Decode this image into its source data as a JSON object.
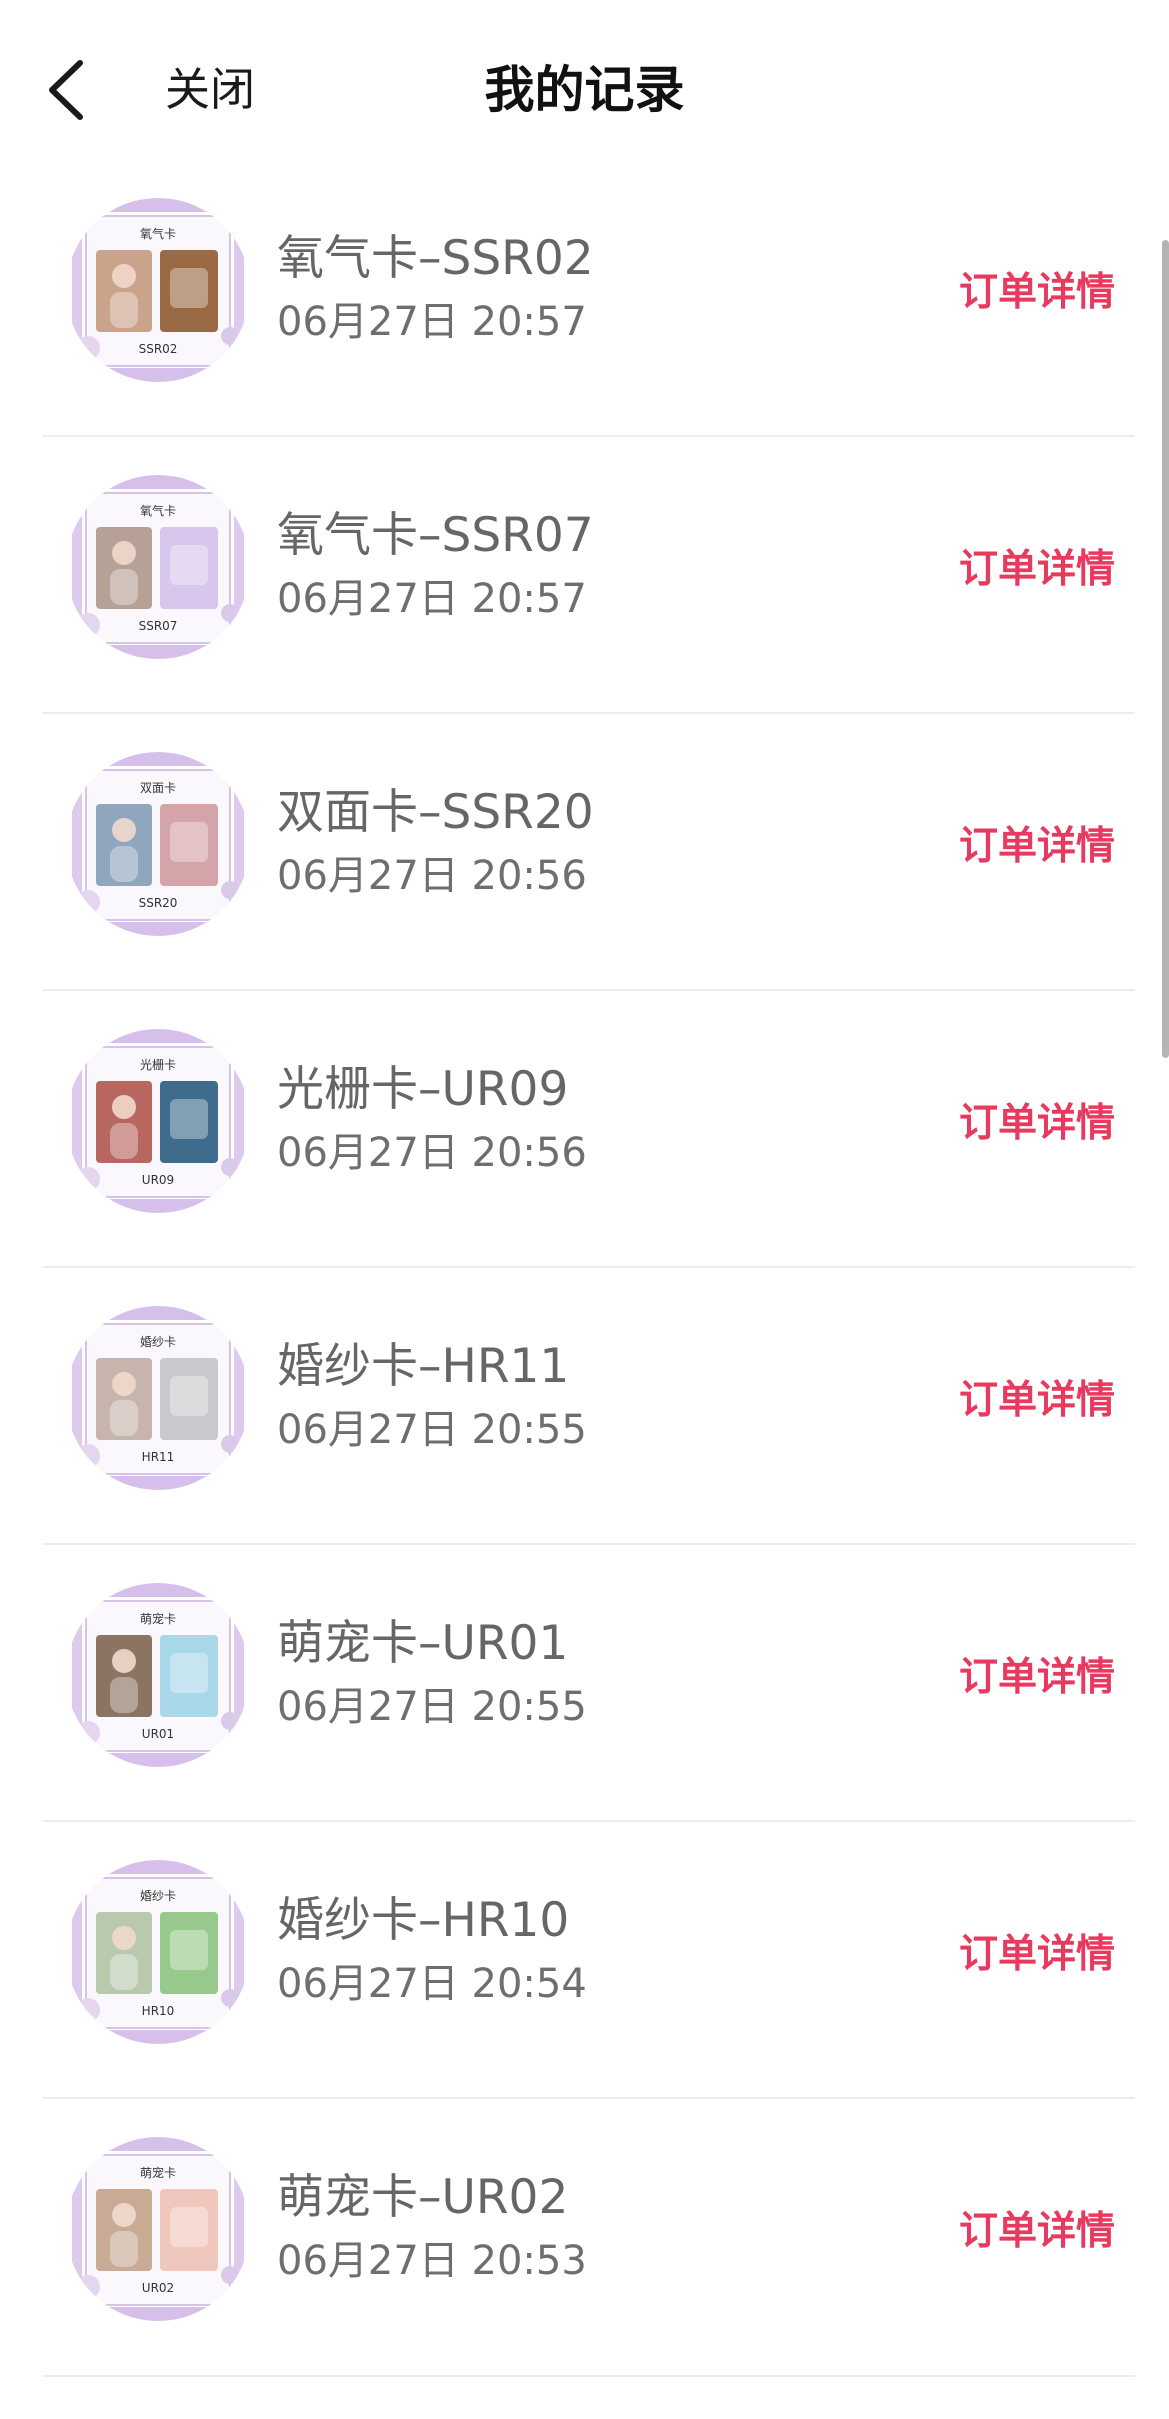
{
  "header": {
    "close_label": "关闭",
    "title": "我的记录"
  },
  "records": [
    {
      "title": "氧气卡–SSR02",
      "time": "06月27日  20:57",
      "action": "订单详情",
      "card_label": "氧气卡",
      "card_code": "SSR02",
      "left_color": "#c9a48a",
      "right_color": "#9a6a45"
    },
    {
      "title": "氧气卡–SSR07",
      "time": "06月27日  20:57",
      "action": "订单详情",
      "card_label": "氧气卡",
      "card_code": "SSR07",
      "left_color": "#b7a196",
      "right_color": "#d8c6ec"
    },
    {
      "title": "双面卡–SSR20",
      "time": "06月27日  20:56",
      "action": "订单详情",
      "card_label": "双面卡",
      "card_code": "SSR20",
      "left_color": "#8fa6be",
      "right_color": "#d5a4a8"
    },
    {
      "title": "光栅卡–UR09",
      "time": "06月27日  20:56",
      "action": "订单详情",
      "card_label": "光栅卡",
      "card_code": "UR09",
      "left_color": "#b86660",
      "right_color": "#3f6c8c"
    },
    {
      "title": "婚纱卡–HR11",
      "time": "06月27日  20:55",
      "action": "订单详情",
      "card_label": "婚纱卡",
      "card_code": "HR11",
      "left_color": "#c7b4ad",
      "right_color": "#c9c9cd"
    },
    {
      "title": "萌宠卡–UR01",
      "time": "06月27日  20:55",
      "action": "订单详情",
      "card_label": "萌宠卡",
      "card_code": "UR01",
      "left_color": "#8c7462",
      "right_color": "#a9d8ea"
    },
    {
      "title": "婚纱卡–HR10",
      "time": "06月27日  20:54",
      "action": "订单详情",
      "card_label": "婚纱卡",
      "card_code": "HR10",
      "left_color": "#b8c9ae",
      "right_color": "#98c98c"
    },
    {
      "title": "萌宠卡–UR02",
      "time": "06月27日  20:53",
      "action": "订单详情",
      "card_label": "萌宠卡",
      "card_code": "UR02",
      "left_color": "#c8aa95",
      "right_color": "#f0c7bd"
    }
  ],
  "icons": {
    "back": "chevron-left-icon"
  },
  "colors": {
    "accent": "#e8395f",
    "frame": "#b48ad8"
  }
}
